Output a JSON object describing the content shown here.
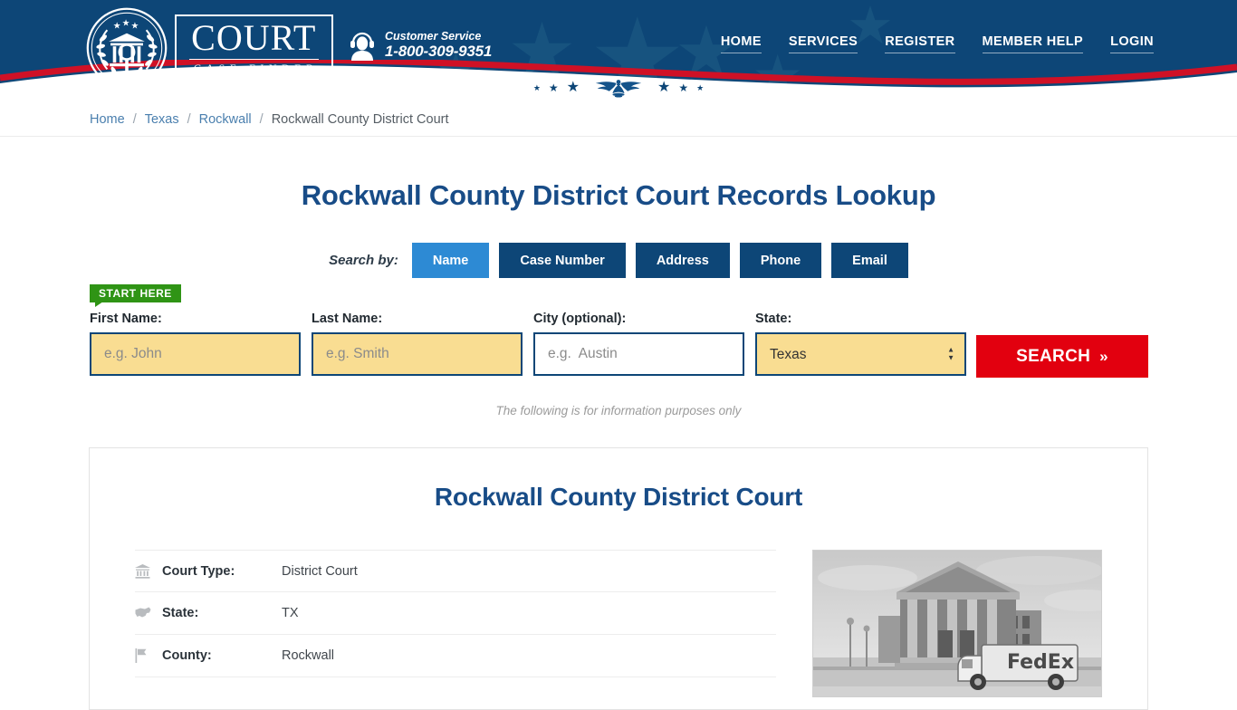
{
  "header": {
    "logo": {
      "seal_icon": "court-seal-icon",
      "primary": "COURT",
      "secondary": "CASE FINDER"
    },
    "customer_service": {
      "icon": "headset-agent-icon",
      "label": "Customer Service",
      "phone": "1-800-309-9351"
    },
    "nav": [
      {
        "label": "HOME",
        "name": "nav-home"
      },
      {
        "label": "SERVICES",
        "name": "nav-services"
      },
      {
        "label": "REGISTER",
        "name": "nav-register"
      },
      {
        "label": "MEMBER HELP",
        "name": "nav-member-help"
      },
      {
        "label": "LOGIN",
        "name": "nav-login"
      }
    ],
    "decor": {
      "eagle_icon": "eagle-emblem-icon",
      "wave_red": "#cf1126",
      "wave_white": "#ffffff",
      "background": "#0d4677"
    }
  },
  "breadcrumb": {
    "items": [
      "Home",
      "Texas",
      "Rockwall"
    ],
    "separator": "/",
    "current": "Rockwall County District Court"
  },
  "main": {
    "page_title": "Rockwall County District Court Records Lookup",
    "search_by_label": "Search by:",
    "tabs": [
      {
        "label": "Name",
        "active": true
      },
      {
        "label": "Case Number",
        "active": false
      },
      {
        "label": "Address",
        "active": false
      },
      {
        "label": "Phone",
        "active": false
      },
      {
        "label": "Email",
        "active": false
      }
    ],
    "start_badge": "START HERE",
    "form": {
      "first_name": {
        "label": "First Name:",
        "placeholder": "e.g. John",
        "value": ""
      },
      "last_name": {
        "label": "Last Name:",
        "placeholder": "e.g. Smith",
        "value": ""
      },
      "city": {
        "label": "City (optional):",
        "placeholder": "e.g.  Austin",
        "value": ""
      },
      "state": {
        "label": "State:",
        "value": "Texas",
        "options": [
          "Texas"
        ]
      },
      "search_button": "SEARCH",
      "search_button_chevron": "»"
    },
    "note": "The following is for information purposes only"
  },
  "card": {
    "title": "Rockwall County District Court",
    "details": [
      {
        "icon": "bank-icon",
        "label": "Court Type:",
        "value": "District Court"
      },
      {
        "icon": "us-map-icon",
        "label": "State:",
        "value": "TX"
      },
      {
        "icon": "flag-icon",
        "label": "County:",
        "value": "Rockwall"
      }
    ],
    "photo": {
      "name": "courthouse-photo",
      "alt": "Courthouse building with delivery truck",
      "caption_in_image": "FedEx"
    }
  },
  "colors": {
    "brand_blue": "#0d4677",
    "accent_blue": "#2d8ad4",
    "title_blue": "#184c87",
    "badge_green": "#2f9415",
    "search_red": "#e2000f",
    "field_yellow": "#f9dd92"
  }
}
